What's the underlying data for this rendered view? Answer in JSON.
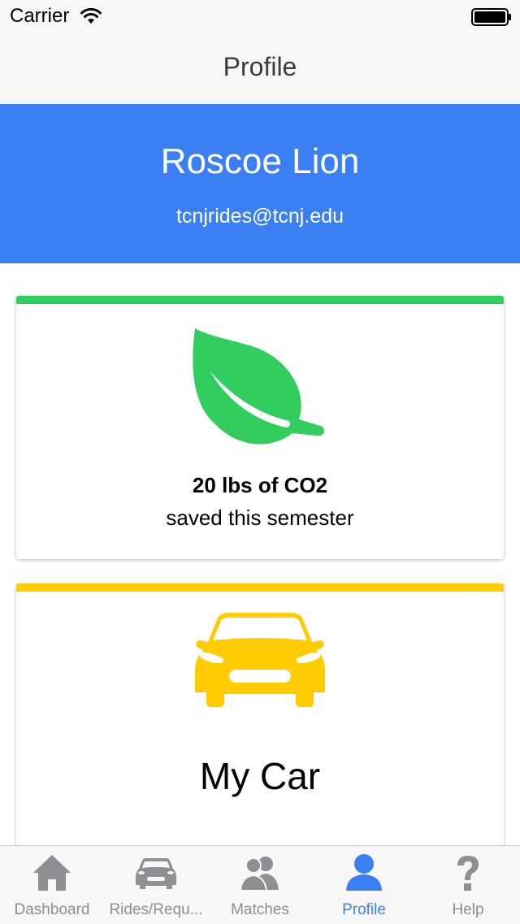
{
  "status_bar": {
    "carrier": "Carrier",
    "wifi_icon": "wifi-icon",
    "battery_icon": "battery-icon"
  },
  "nav": {
    "title": "Profile"
  },
  "profile": {
    "name": "Roscoe Lion",
    "email": "tcnjrides@tcnj.edu"
  },
  "co2_card": {
    "icon": "leaf-icon",
    "amount": "20 lbs of CO2",
    "caption": "saved this semester",
    "accent_color": "#32cd5f"
  },
  "car_card": {
    "icon": "car-icon",
    "title": "My Car",
    "accent_color": "#ffcc00"
  },
  "tabs": [
    {
      "label": "Dashboard",
      "icon": "home-icon"
    },
    {
      "label": "Rides/Requ...",
      "icon": "car-icon"
    },
    {
      "label": "Matches",
      "icon": "users-icon"
    },
    {
      "label": "Profile",
      "icon": "user-icon",
      "selected": true
    },
    {
      "label": "Help",
      "icon": "question-icon"
    }
  ],
  "colors": {
    "header": "#3b7ff5",
    "tab_active": "#3b7ff5",
    "tab_inactive": "#8e8e93"
  }
}
